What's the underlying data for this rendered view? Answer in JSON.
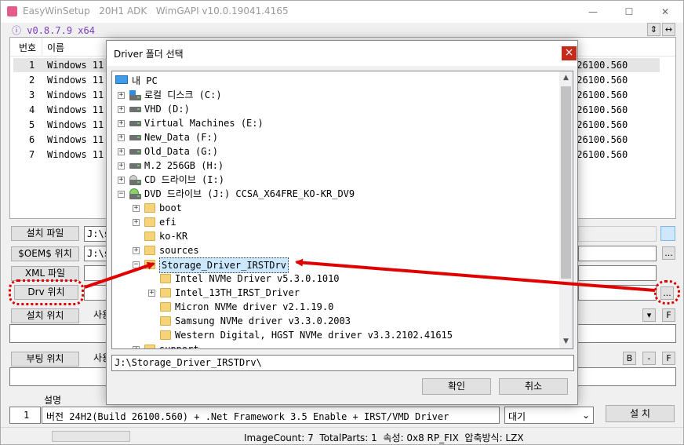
{
  "app": {
    "title": "EasyWinSetup   20H1 ADK   WimGAPI v10.0.19041.4165",
    "version": "v0.8.7.9 x64",
    "version_icon": "ⓘ"
  },
  "list": {
    "headers": [
      "번호",
      "이름"
    ],
    "rows": [
      {
        "num": "1",
        "name": "Windows 11",
        "ver": ".26100.560"
      },
      {
        "num": "2",
        "name": "Windows 11",
        "ver": ".26100.560"
      },
      {
        "num": "3",
        "name": "Windows 11",
        "ver": ".26100.560"
      },
      {
        "num": "4",
        "name": "Windows 11",
        "ver": ".26100.560"
      },
      {
        "num": "5",
        "name": "Windows 11",
        "ver": ".26100.560"
      },
      {
        "num": "6",
        "name": "Windows 11",
        "ver": ".26100.560"
      },
      {
        "num": "7",
        "name": "Windows 11",
        "ver": ".26100.560"
      }
    ]
  },
  "form": {
    "install_file_label": "설치 파일",
    "install_file_value": "J:\\s",
    "oem_label": "$OEM$ 위치",
    "oem_value": "J:\\s",
    "xml_label": "XML 파일",
    "drv_label": "Drv 위치",
    "install_loc_label": "설치 위치",
    "install_loc_note": "사용",
    "boot_loc_label": "부팅 위치",
    "boot_loc_note": "사용",
    "browse_label": "...",
    "b_label": "B",
    "minus_label": "-",
    "f_label": "F",
    "desc_header": "설명",
    "desc_num": "1",
    "desc_text": "버전 24H2(Build 26100.560) + .Net Framework 3.5 Enable + IRST/VMD Driver",
    "status_select": "대기",
    "install_button": "설 치"
  },
  "statusbar": {
    "text": "ImageCount: 7  TotalParts: 1  속성: 0x8 RP_FIX  압축방식: LZX"
  },
  "dialog": {
    "title": "Driver 폴더 선택",
    "close": "×",
    "path_value": "J:\\Storage_Driver_IRSTDrv\\",
    "ok": "확인",
    "cancel": "취소",
    "tree": [
      {
        "label": "내 PC"
      },
      {
        "label": "로컬 디스크 (C:)"
      },
      {
        "label": "VHD (D:)"
      },
      {
        "label": "Virtual Machines (E:)"
      },
      {
        "label": "New_Data (F:)"
      },
      {
        "label": "Old_Data (G:)"
      },
      {
        "label": "M.2 256GB (H:)"
      },
      {
        "label": "CD 드라이브 (I:)"
      },
      {
        "label": "DVD 드라이브 (J:) CCSA_X64FRE_KO-KR_DV9"
      },
      {
        "label": "boot"
      },
      {
        "label": "efi"
      },
      {
        "label": "ko-KR"
      },
      {
        "label": "sources"
      },
      {
        "label": "Storage_Driver_IRSTDrv"
      },
      {
        "label": "Intel NVMe Driver v5.3.0.1010"
      },
      {
        "label": "Intel_13TH_IRST_Driver"
      },
      {
        "label": "Micron NVMe driver v2.1.19.0"
      },
      {
        "label": "Samsung NVMe driver v3.3.0.2003"
      },
      {
        "label": "Western Digital, HGST NVMe driver v3.3.2102.41615"
      },
      {
        "label": "support"
      }
    ]
  },
  "colors": {
    "annotation": "#e00000",
    "selection": "#cce8ff",
    "accent": "#0078d7"
  }
}
